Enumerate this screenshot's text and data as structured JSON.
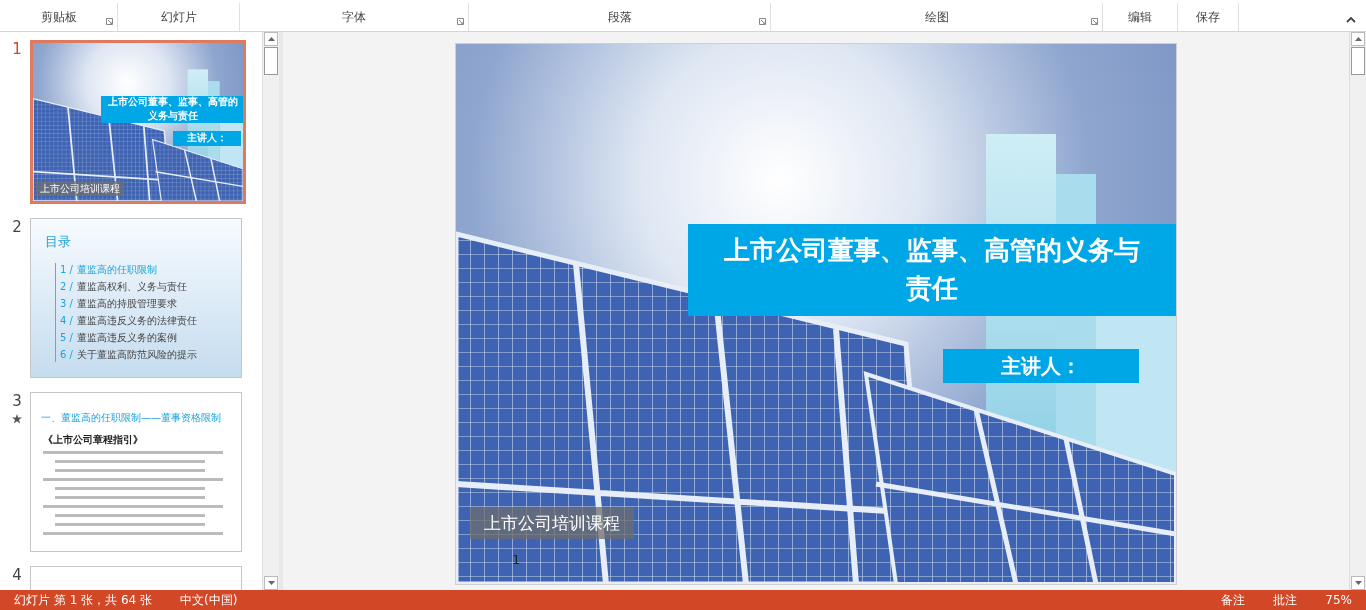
{
  "ribbon_groups": [
    {
      "label": "剪贴板",
      "launcher": true
    },
    {
      "label": "幻灯片",
      "launcher": false
    },
    {
      "label": "字体",
      "launcher": true
    },
    {
      "label": "段落",
      "launcher": true
    },
    {
      "label": "绘图",
      "launcher": true
    },
    {
      "label": "编辑",
      "launcher": false
    },
    {
      "label": "保存",
      "launcher": false
    }
  ],
  "thumbnails": [
    {
      "number": "1",
      "selected": true,
      "animation": false,
      "kind": "title",
      "title": "上市公司董事、监事、高管的义务与责任",
      "presenter": "主讲人：",
      "footer": "上市公司培训课程"
    },
    {
      "number": "2",
      "selected": false,
      "animation": false,
      "kind": "toc",
      "heading": "目录",
      "items": [
        {
          "number": "1 /",
          "text": "董监高的任职限制",
          "selected": true
        },
        {
          "number": "2 /",
          "text": "董监高权利、义务与责任",
          "selected": false
        },
        {
          "number": "3 /",
          "text": "董监高的持股管理要求",
          "selected": false
        },
        {
          "number": "4 /",
          "text": "董监高违反义务的法律责任",
          "selected": false
        },
        {
          "number": "5 /",
          "text": "董监高违反义务的案例",
          "selected": false
        },
        {
          "number": "6 /",
          "text": "关于董监高防范风险的提示",
          "selected": false
        }
      ]
    },
    {
      "number": "3",
      "selected": false,
      "animation": true,
      "kind": "content",
      "heading": "一、董监高的任职限制——董事资格限制",
      "source": "《上市公司章程指引》"
    },
    {
      "number": "4",
      "selected": false,
      "animation": false,
      "kind": "cut"
    }
  ],
  "slide": {
    "title": "上市公司董事、监事、高管的义务与责任",
    "presenter": "主讲人：",
    "footer": "上市公司培训课程",
    "page_number": "1"
  },
  "status_bar": {
    "slide_info": "幻灯片 第 1 张，共 64 张",
    "language": "中文(中国)",
    "notes": "备注",
    "comments": "批注",
    "zoom": "75%"
  }
}
